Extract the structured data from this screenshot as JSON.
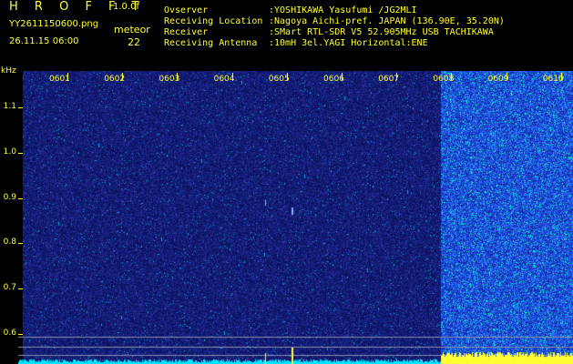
{
  "header": {
    "app_title": "H R O F F T",
    "app_version": "1.0.0f",
    "filename": "YY2611150600.png",
    "datetime": "26.11.15 06:00",
    "meteor_label": "meteor",
    "meteor_count": "22"
  },
  "info": [
    {
      "key": "Ovserver",
      "value": ":YOSHIKAWA Yasufumi /JG2MLI"
    },
    {
      "key": "Receiving Location",
      "value": ":Nagoya Aichi-pref. JAPAN (136.90E, 35.20N)"
    },
    {
      "key": "Receiver",
      "value": ":SMart RTL-SDR V5 52.905MHz USB TACHIKAWA"
    },
    {
      "key": "Receiving Antenna",
      "value": ":10mH 3el.YAGI Horizontal:ENE"
    }
  ],
  "chart_data": {
    "type": "heatmap",
    "ylabel": "kHz",
    "ylim": [
      0.58,
      1.18
    ],
    "y_ticks": [
      "1.1",
      "1.0",
      "0.9",
      "0.8",
      "0.7",
      "0.6"
    ],
    "x_ticks": [
      "0601",
      "0602",
      "0603",
      "0604",
      "0605",
      "0606",
      "0607",
      "0608",
      "0609",
      "0610"
    ],
    "bright_from_minute": "0608",
    "colors": {
      "background": "#0a0f5a",
      "noise_dark": "#1c2890",
      "noise_bright": "#2b6cff",
      "high_intensity": "#00ffcc",
      "baseline": "#00e5ff",
      "strong": "#ffff33"
    }
  }
}
